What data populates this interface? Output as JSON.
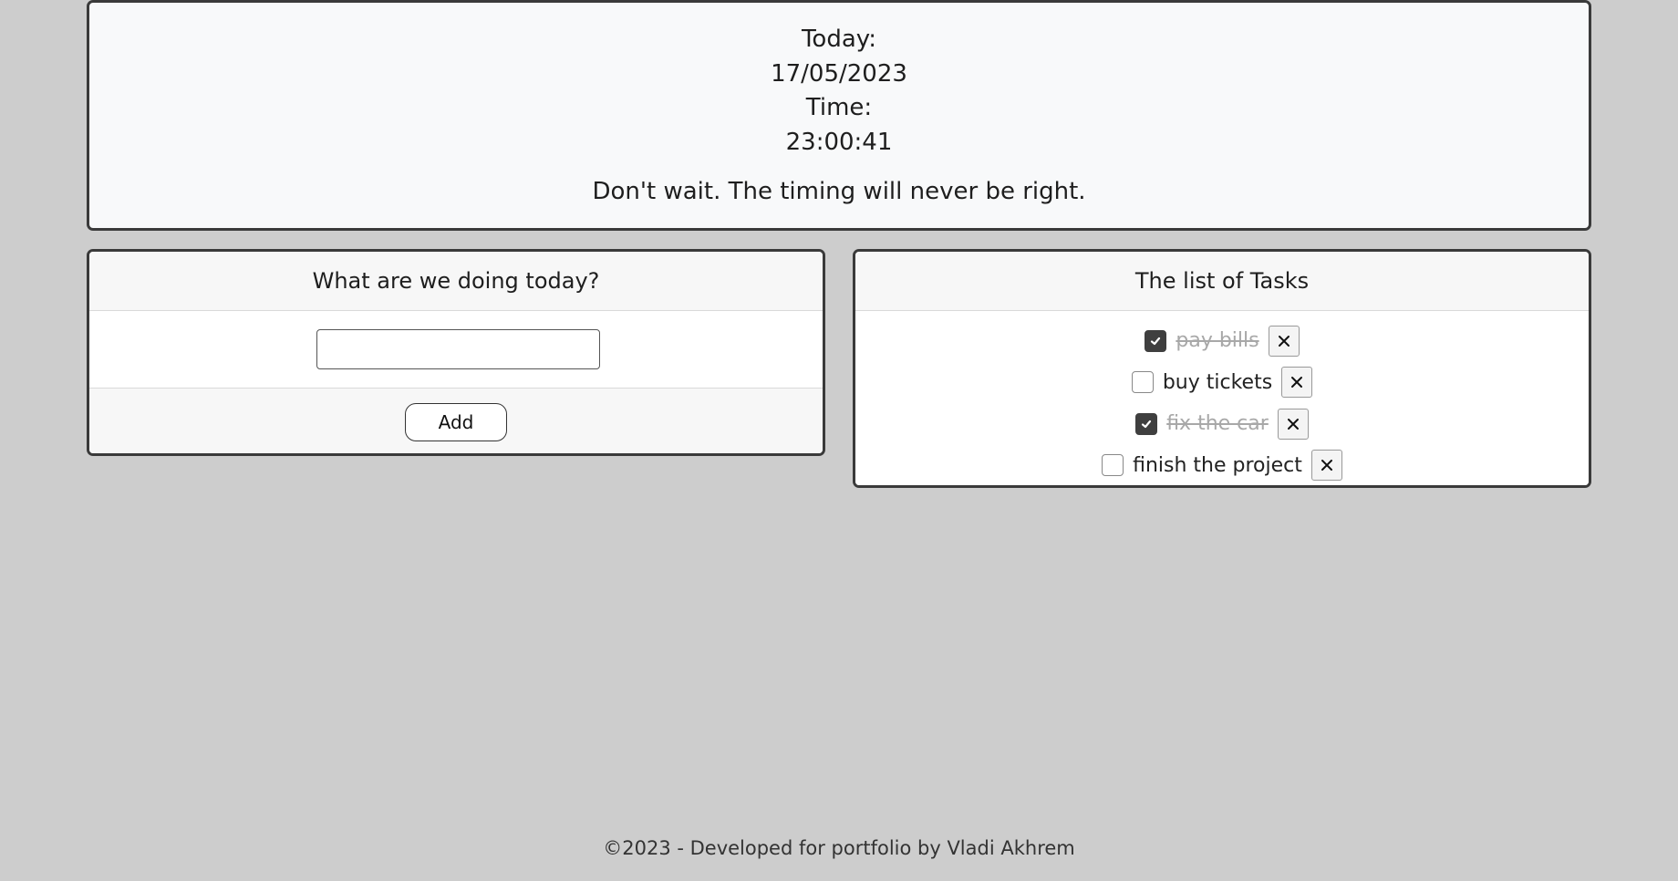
{
  "clock": {
    "date_label": "Today:",
    "date_value": "17/05/2023",
    "time_label": "Time:",
    "time_value": "23:00:41"
  },
  "quote": "Don't wait. The timing will never be right.",
  "add_panel": {
    "title": "What are we doing today?",
    "input_value": "",
    "add_label": "Add"
  },
  "task_panel": {
    "title": "The list of Tasks",
    "tasks": [
      {
        "text": "pay bills",
        "done": true
      },
      {
        "text": "buy tickets",
        "done": false
      },
      {
        "text": "fix the car",
        "done": true
      },
      {
        "text": "finish the project",
        "done": false
      }
    ]
  },
  "icons": {
    "checkmark": "check-icon",
    "delete": "close-icon"
  },
  "colors": {
    "background": "#cdcdcd",
    "card": "#f8f9fa",
    "border": "#3a3a3a",
    "checked": "#3f3f3f",
    "done_text": "#a8a8a8"
  },
  "footer": "©2023 - Developed for portfolio by Vladi Akhrem"
}
